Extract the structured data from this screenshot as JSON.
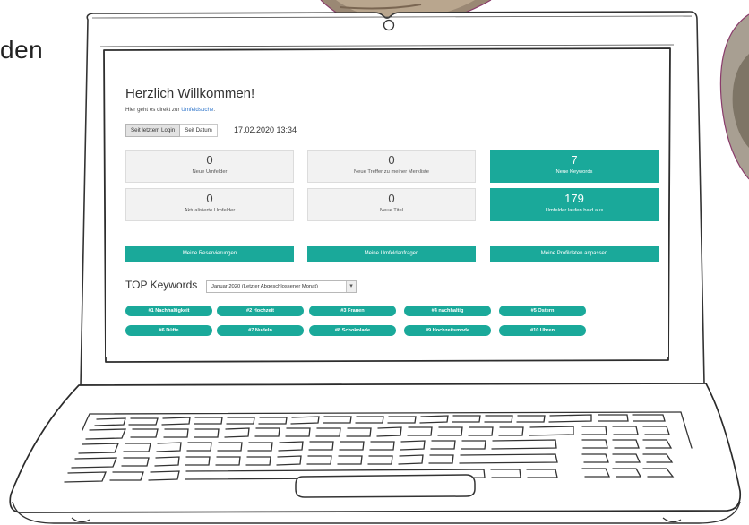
{
  "side_text": "den",
  "header": {
    "title": "Herzlich Willkommen!",
    "sub_prefix": "Hier geht es direkt zur",
    "sub_link": "Umfeldsuche",
    "sub_suffix": "."
  },
  "filter": {
    "options": [
      "Seit letztem Login",
      "Seit Datum"
    ],
    "date": "17.02.2020 13:34"
  },
  "stats": [
    {
      "num": "0",
      "label": "Neue Umfelder"
    },
    {
      "num": "0",
      "label": "Neue Treffer zu meiner Merkliste"
    },
    {
      "num": "7",
      "label": "Neue Keywords"
    },
    {
      "num": "0",
      "label": "Aktualisierte Umfelder"
    },
    {
      "num": "0",
      "label": "Neue Titel"
    },
    {
      "num": "179",
      "label": "Umfelder laufen bald aus"
    }
  ],
  "actions": [
    "Meine Reservierungen",
    "Meine Umfeldanfragen",
    "Meine Profildaten anpassen"
  ],
  "keywords": {
    "label": "TOP Keywords",
    "selected": "Januar 2020 (Letzter Abgeschlossener Monat)",
    "items": [
      "#1 Nachhaltigkeit",
      "#2 Hochzeit",
      "#3 Frauen",
      "#4 nachhaltig",
      "#5 Ostern",
      "#6 Düfte",
      "#7 Nudeln",
      "#8 Schokolade",
      "#9 Hochzeitsmode",
      "#10 Uhren"
    ]
  },
  "colors": {
    "accent": "#1aa99a",
    "link": "#2a72c9"
  }
}
